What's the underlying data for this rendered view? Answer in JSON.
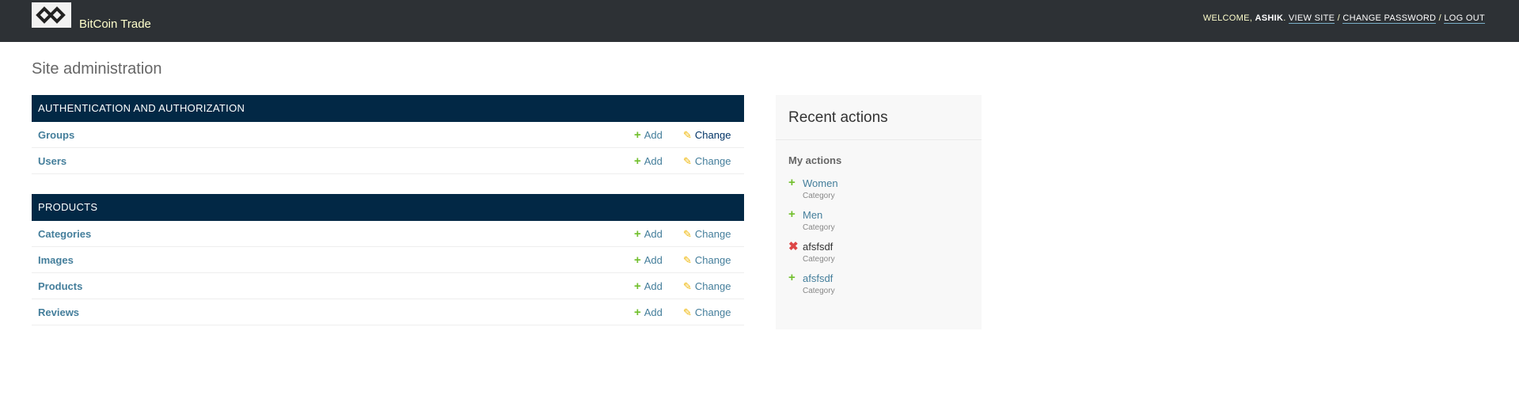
{
  "header": {
    "brand": "BitCoin Trade",
    "welcome": "WELCOME, ",
    "user": "ASHIK",
    "view_site": "VIEW SITE",
    "change_password": "CHANGE PASSWORD",
    "log_out": "LOG OUT",
    "sep": " / "
  },
  "page_title": "Site administration",
  "modules": [
    {
      "title": "AUTHENTICATION AND AUTHORIZATION",
      "rows": [
        {
          "name": "Groups"
        },
        {
          "name": "Users"
        }
      ]
    },
    {
      "title": "PRODUCTS",
      "rows": [
        {
          "name": "Categories"
        },
        {
          "name": "Images"
        },
        {
          "name": "Products"
        },
        {
          "name": "Reviews"
        }
      ]
    }
  ],
  "labels": {
    "add": "Add",
    "change": "Change"
  },
  "recent": {
    "title": "Recent actions",
    "subtitle": "My actions",
    "items": [
      {
        "name": "Women",
        "type": "Category",
        "action": "add"
      },
      {
        "name": "Men",
        "type": "Category",
        "action": "add"
      },
      {
        "name": "afsfsdf",
        "type": "Category",
        "action": "delete"
      },
      {
        "name": "afsfsdf",
        "type": "Category",
        "action": "add"
      }
    ]
  },
  "colors": {
    "header": "#2d3135",
    "module_header": "#022845",
    "link": "#447e9b",
    "add": "#70bf2b",
    "delete": "#dd4646",
    "change": "#efb80b"
  }
}
